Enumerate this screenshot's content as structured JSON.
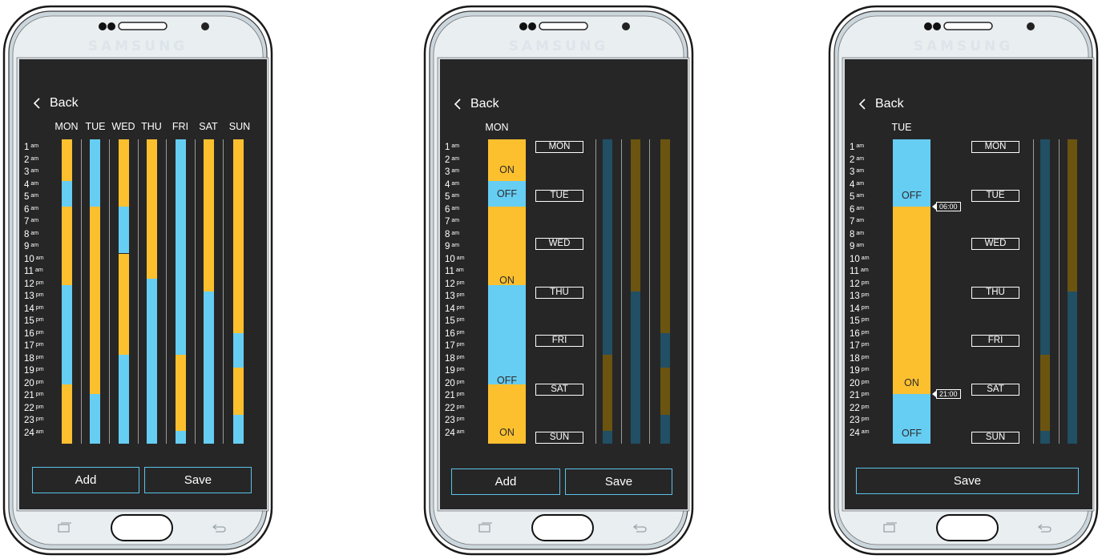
{
  "brand": "SAMSUNG",
  "colors": {
    "on": "#fcc02f",
    "off": "#66cdf3",
    "screen": "#272627",
    "button_border": "#58c3e8",
    "dim_on": "#6b540f",
    "dim_off": "#214f63"
  },
  "hours": [
    {
      "n": "1",
      "s": "am"
    },
    {
      "n": "2",
      "s": "am"
    },
    {
      "n": "3",
      "s": "am"
    },
    {
      "n": "4",
      "s": "am"
    },
    {
      "n": "5",
      "s": "am"
    },
    {
      "n": "6",
      "s": "am"
    },
    {
      "n": "7",
      "s": "am"
    },
    {
      "n": "8",
      "s": "am"
    },
    {
      "n": "9",
      "s": "am"
    },
    {
      "n": "10",
      "s": "am"
    },
    {
      "n": "11",
      "s": "am"
    },
    {
      "n": "12",
      "s": "pm"
    },
    {
      "n": "13",
      "s": "pm"
    },
    {
      "n": "14",
      "s": "pm"
    },
    {
      "n": "15",
      "s": "pm"
    },
    {
      "n": "16",
      "s": "pm"
    },
    {
      "n": "17",
      "s": "pm"
    },
    {
      "n": "18",
      "s": "pm"
    },
    {
      "n": "19",
      "s": "pm"
    },
    {
      "n": "20",
      "s": "pm"
    },
    {
      "n": "21",
      "s": "pm"
    },
    {
      "n": "22",
      "s": "pm"
    },
    {
      "n": "23",
      "s": "pm"
    },
    {
      "n": "24",
      "s": "am"
    }
  ],
  "week": [
    {
      "day": "MON",
      "segments": [
        {
          "state": "on",
          "end": 3.3
        },
        {
          "state": "off",
          "end": 5.3
        },
        {
          "state": "on",
          "end": 11.5
        },
        {
          "state": "off",
          "end": 19.3
        },
        {
          "state": "on",
          "end": 24
        }
      ]
    },
    {
      "day": "TUE",
      "segments": [
        {
          "state": "off",
          "end": 5.3
        },
        {
          "state": "on",
          "end": 20.1
        },
        {
          "state": "off",
          "end": 24
        }
      ]
    },
    {
      "day": "WED",
      "segments": [
        {
          "state": "on",
          "end": 5.3
        },
        {
          "state": "off",
          "end": 9
        },
        {
          "state": "on",
          "end": 17
        },
        {
          "state": "off",
          "end": 24
        }
      ]
    },
    {
      "day": "THU",
      "segments": [
        {
          "state": "on",
          "end": 11
        },
        {
          "state": "off",
          "end": 24
        }
      ]
    },
    {
      "day": "FRI",
      "segments": [
        {
          "state": "off",
          "end": 17
        },
        {
          "state": "on",
          "end": 23
        },
        {
          "state": "off",
          "end": 24
        }
      ]
    },
    {
      "day": "SAT",
      "segments": [
        {
          "state": "on",
          "end": 12
        },
        {
          "state": "off",
          "end": 24
        }
      ]
    },
    {
      "day": "SUN",
      "segments": [
        {
          "state": "on",
          "end": 15.3
        },
        {
          "state": "off",
          "end": 18
        },
        {
          "state": "on",
          "end": 21.7
        },
        {
          "state": "off",
          "end": 24
        }
      ]
    }
  ],
  "screen1": {
    "back_label": "Back",
    "add_label": "Add",
    "save_label": "Save"
  },
  "screen2": {
    "back_label": "Back",
    "day": "MON",
    "add_label": "Add",
    "save_label": "Save",
    "segment_labels": [
      {
        "text": "ON",
        "at": 2.4
      },
      {
        "text": "OFF",
        "at": 4.3
      },
      {
        "text": "ON",
        "at": 11.1
      },
      {
        "text": "OFF",
        "at": 19
      },
      {
        "text": "ON",
        "at": 23.1
      }
    ]
  },
  "screen3": {
    "back_label": "Back",
    "day": "TUE",
    "save_label": "Save",
    "segment_labels": [
      {
        "text": "OFF",
        "at": 4.4
      },
      {
        "text": "ON",
        "at": 19.2
      },
      {
        "text": "OFF",
        "at": 23.2
      }
    ],
    "time_badges": [
      {
        "text": "06:00",
        "at": 5.3
      },
      {
        "text": "21:00",
        "at": 20.1
      }
    ]
  },
  "day_list": [
    "MON",
    "TUE",
    "WED",
    "THU",
    "FRI",
    "SAT",
    "SUN"
  ]
}
